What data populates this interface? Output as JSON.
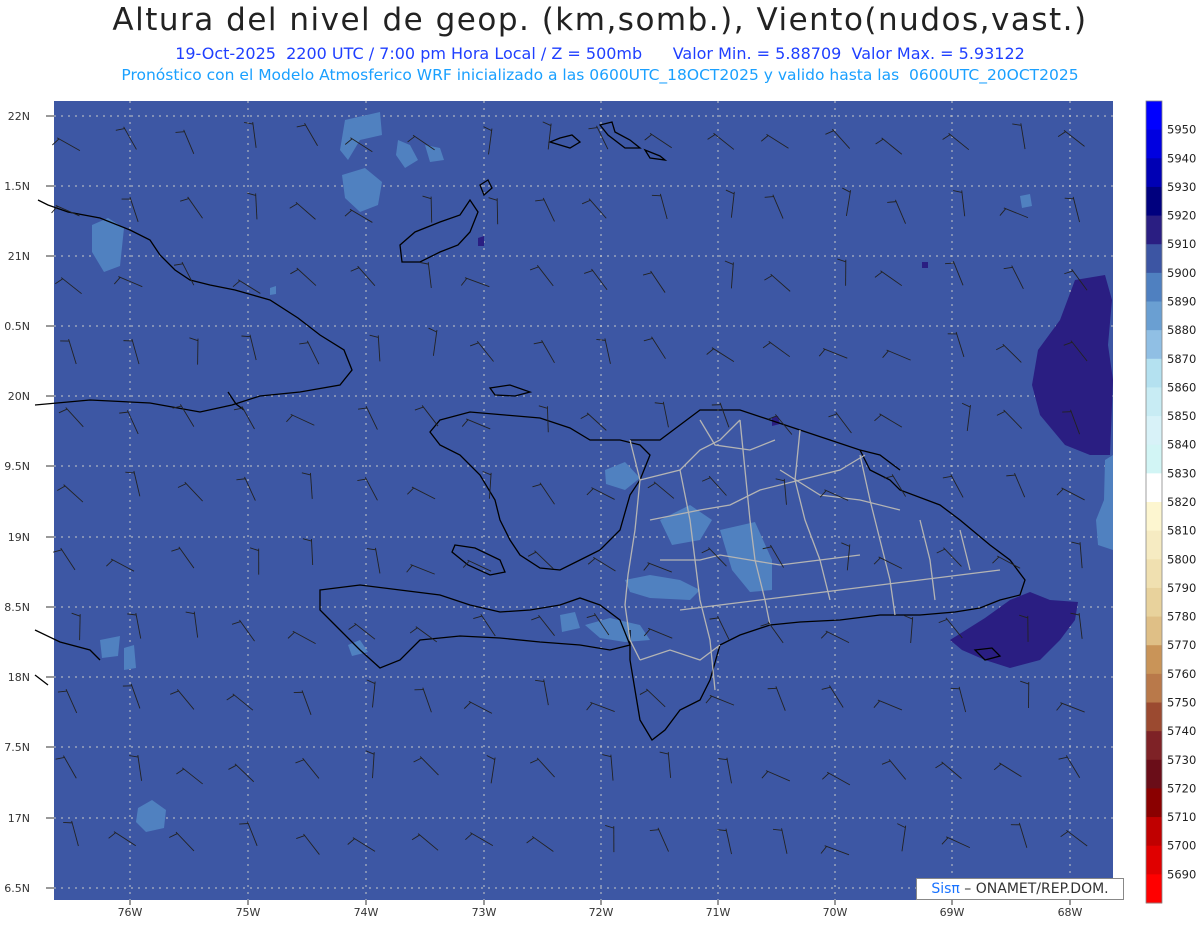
{
  "header": {
    "title": "Altura del nivel de geop. (km,somb.), Viento(nudos,vast.)",
    "line1_left": "19-Oct-2025  2200 UTC / 7:00 pm Hora Local / Z = 500mb",
    "line1_right": "Valor Min. = 5.88709  Valor Max. = 5.93122",
    "line2": "Pronóstico con el Modelo Atmosferico WRF inicializado a las 0600UTC_18OCT2025 y valido hasta las  0600UTC_20OCT2025"
  },
  "axes": {
    "lat_labels": [
      "22N",
      "1.5N",
      "21N",
      "0.5N",
      "20N",
      "9.5N",
      "19N",
      "8.5N",
      "18N",
      "7.5N",
      "17N",
      "6.5N"
    ],
    "lon_labels": [
      "76W",
      "75W",
      "74W",
      "73W",
      "72W",
      "71W",
      "70W",
      "69W",
      "68W"
    ]
  },
  "colorbar": {
    "levels": [
      "5950",
      "5940",
      "5930",
      "5920",
      "5910",
      "5900",
      "5890",
      "5880",
      "5870",
      "5860",
      "5850",
      "5840",
      "5830",
      "5820",
      "5810",
      "5800",
      "5790",
      "5780",
      "5770",
      "5760",
      "5750",
      "5740",
      "5730",
      "5720",
      "5710",
      "5700",
      "5690"
    ],
    "colors": [
      "#0000ff",
      "#0000e0",
      "#0000b4",
      "#00007e",
      "#2a1e82",
      "#3c55a3",
      "#4f80c0",
      "#6a9fd2",
      "#90bfe4",
      "#b4e1f0",
      "#c8ecf4",
      "#d8f2f8",
      "#d2f5f5",
      "#ffffff",
      "#fdf6d0",
      "#f6ebc2",
      "#f0e0b0",
      "#e8d29c",
      "#dfbf86",
      "#c99458",
      "#b9794a",
      "#9b4a30",
      "#7e2226",
      "#6a0d18",
      "#8a0000",
      "#c00000",
      "#e00000",
      "#ff0000"
    ]
  },
  "map": {
    "background_color": "#3d57a4",
    "region": "Hispaniola / Greater Antilles"
  },
  "credit": {
    "sis": "Sisπ",
    "rest": " – ONAMET/REP.DOM."
  }
}
